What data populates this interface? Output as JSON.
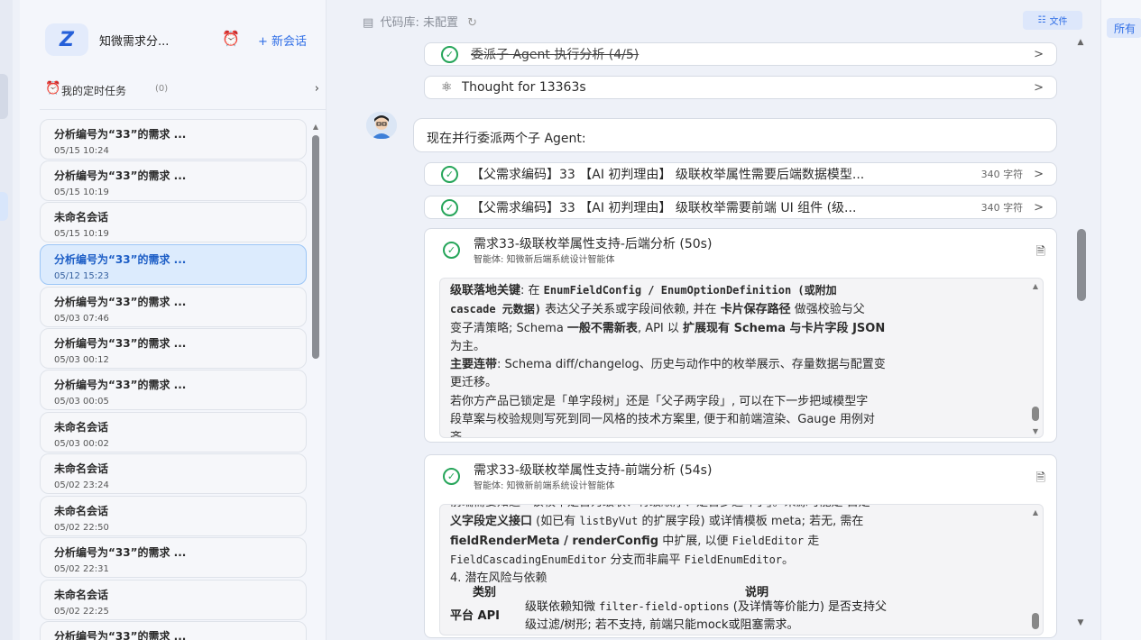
{
  "sidebar": {
    "title": "知微需求分...",
    "new_chat": "+ 新会话",
    "scheduled_label": "我的定时任务",
    "scheduled_count": "(0)",
    "conversations": [
      {
        "title": "分析编号为“33”的需求 ...",
        "date": "05/15 10:24"
      },
      {
        "title": "分析编号为“33”的需求 ...",
        "date": "05/15 10:19"
      },
      {
        "title": "未命名会话",
        "date": "05/15 10:19"
      },
      {
        "title": "分析编号为“33”的需求 ...",
        "date": "05/12 15:23"
      },
      {
        "title": "分析编号为“33”的需求 ...",
        "date": "05/03 07:46"
      },
      {
        "title": "分析编号为“33”的需求 ...",
        "date": "05/03 00:12"
      },
      {
        "title": "分析编号为“33”的需求 ...",
        "date": "05/03 00:05"
      },
      {
        "title": "未命名会话",
        "date": "05/03 00:02"
      },
      {
        "title": "未命名会话",
        "date": "05/02 23:24"
      },
      {
        "title": "未命名会话",
        "date": "05/02 22:50"
      },
      {
        "title": "分析编号为“33”的需求 ...",
        "date": "05/02 22:31"
      },
      {
        "title": "未命名会话",
        "date": "05/02 22:25"
      },
      {
        "title": "分析编号为“33”的需求 ...",
        "date": ""
      }
    ]
  },
  "topbar": {
    "repo_label": "代码库: 未配置",
    "file_button": "文件"
  },
  "right_panel": {
    "all_label": "所有"
  },
  "steps": {
    "delegate": "委派子 Agent 执行分析 (4/5)",
    "thought": "Thought for 13363s"
  },
  "message": "现在并行委派两个子 Agent:",
  "subtasks": [
    {
      "text": "【父需求编码】33 【AI 初判理由】 级联枚举属性需要后端数据模型...",
      "chars": "340 字符"
    },
    {
      "text": "【父需求编码】33 【AI 初判理由】 级联枚举需要前端 UI 组件 (级...",
      "chars": "340 字符"
    }
  ],
  "card1": {
    "title": "需求33-级联枚举属性支持-后端分析 (50s)",
    "agent": "智能体: 知微新后端系统设计智能体",
    "l1_a": "级联落地关键",
    "l1_b": ": 在 ",
    "l1_c": "EnumFieldConfig / EnumOptionDefinition (或附加",
    "l2_a": "cascade 元数据)",
    "l2_b": " 表达父子关系或字段间依赖, 并在 ",
    "l2_c": "卡片保存路径",
    "l2_d": " 做强校验与父",
    "l3_a": "变子清策略; Schema ",
    "l3_b": "一般不需新表",
    "l3_c": ", API 以 ",
    "l3_d": "扩展现有 Schema 与卡片字段 JSON",
    "l4": "为主。",
    "l5_a": "主要连带",
    "l5_b": ": Schema diff/changelog、历史与动作中的枚举展示、存量数据与配置变",
    "l6": "更迁移。",
    "l7": "若你方产品已锁定是「单字段树」还是「父子两字段」, 可以在下一步把域模型字",
    "l8": "段草案与校验规则写死到同一风格的技术方案里, 便于和前端渲染、Gauge 用例对",
    "l9": "齐。"
  },
  "card2": {
    "title": "需求33-级联枚举属性支持-前端分析 (54s)",
    "agent": "智能体: 知微新前端系统设计智能体",
    "l0": "前端需要知道「该枚举是否为级联、有级顺序、是否多选叶子」。来源可能是 自定",
    "l1_a": "义字段定义接口",
    "l1_b": " (如已有 ",
    "l1_c": "listByVut",
    "l1_d": " 的扩展字段) 或详情模板 meta; 若无, 需在",
    "l2_a": "fieldRenderMeta / renderConfig",
    "l2_b": " 中扩展, 以便 ",
    "l2_c": "FieldEditor",
    "l2_d": " 走",
    "l3_a": "FieldCascadingEnumEditor",
    "l3_b": " 分支而非扁平 ",
    "l3_c": "FieldEnumEditor",
    "l3_d": "。",
    "l4": "4. 潜在风险与依赖",
    "table_h1": "类别",
    "table_h2": "说明",
    "row_cat": "平台 API",
    "row_desc1_a": "级联依赖知微 ",
    "row_desc1_b": "filter-field-options",
    "row_desc1_c": " (及详情等价能力) 是否支持父",
    "row_desc2": "级过滤/树形; 若不支持, 前端只能mock或阻塞需求。"
  }
}
